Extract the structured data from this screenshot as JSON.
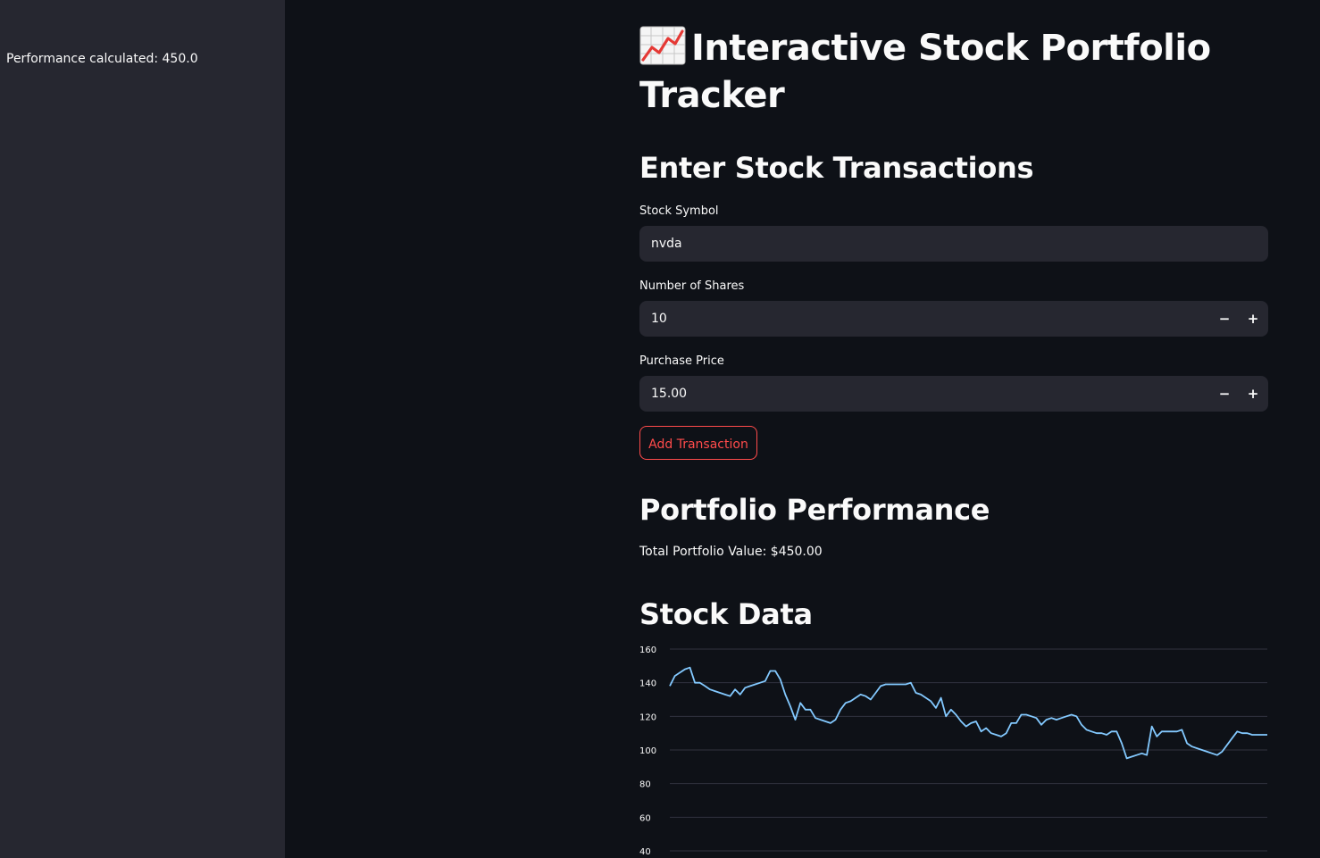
{
  "sidebar": {
    "performance_text": "Performance calculated: 450.0"
  },
  "header": {
    "title_icon": "chart-increasing-icon",
    "title": "Interactive Stock Portfolio Tracker"
  },
  "transactions": {
    "heading": "Enter Stock Transactions",
    "symbol_label": "Stock Symbol",
    "symbol_value": "nvda",
    "shares_label": "Number of Shares",
    "shares_value": "10",
    "price_label": "Purchase Price",
    "price_value": "15.00",
    "minus_label": "−",
    "plus_label": "+",
    "add_button_label": "Add Transaction"
  },
  "performance": {
    "heading": "Portfolio Performance",
    "total_text": "Total Portfolio Value: $450.00"
  },
  "stock_data": {
    "heading": "Stock Data"
  },
  "colors": {
    "background": "#0e1117",
    "sidebar": "#262730",
    "accent": "#ff4b4b",
    "line": "#83c9ff",
    "grid": "#31333f"
  },
  "chart_data": {
    "type": "line",
    "title": "",
    "xlabel": "",
    "ylabel": "",
    "yticks": [
      "160",
      "140",
      "120",
      "100",
      "80",
      "60",
      "40"
    ],
    "ylim": [
      40,
      160
    ],
    "grid": true,
    "series": [
      {
        "values": [
          138,
          144,
          146,
          148,
          149,
          140,
          140,
          138,
          136,
          135,
          134,
          133,
          132,
          136,
          133,
          137,
          138,
          139,
          140,
          141,
          147,
          147,
          142,
          133,
          126,
          118,
          128,
          124,
          124,
          119,
          118,
          117,
          116,
          118,
          124,
          128,
          129,
          131,
          133,
          132,
          130,
          134,
          138,
          139,
          139,
          139,
          139,
          139,
          140,
          134,
          133,
          131,
          129,
          125,
          131,
          120,
          124,
          121,
          117,
          114,
          116,
          117,
          111,
          113,
          110,
          109,
          108,
          110,
          116,
          116,
          121,
          121,
          120,
          119,
          115,
          118,
          119,
          118,
          119,
          120,
          121,
          120,
          115,
          112,
          111,
          110,
          110,
          109,
          111,
          111,
          104,
          95,
          96,
          97,
          98,
          97,
          114,
          108,
          111,
          111,
          111,
          111,
          112,
          104,
          102,
          101,
          100,
          99,
          98,
          97,
          99,
          103,
          107,
          111,
          110,
          110,
          109,
          109,
          109,
          109
        ]
      }
    ]
  }
}
